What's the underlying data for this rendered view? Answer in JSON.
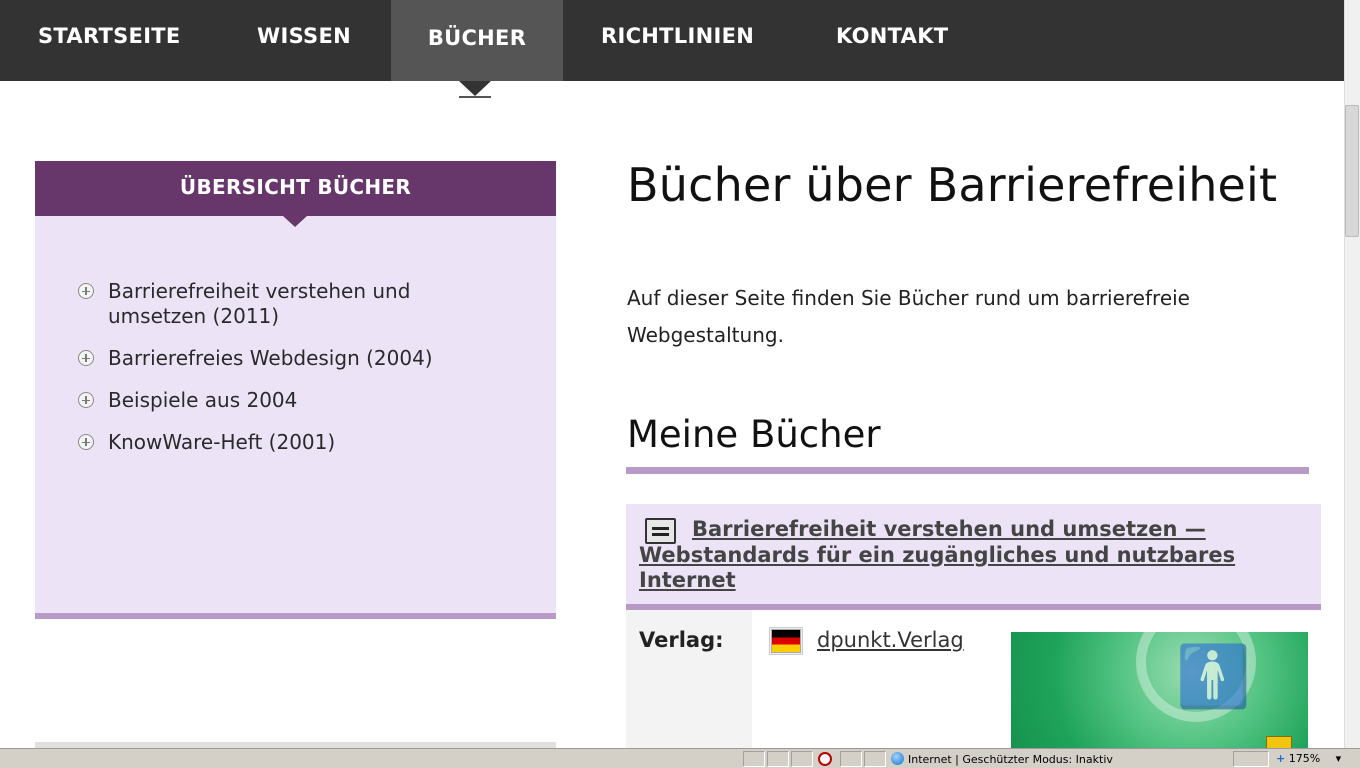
{
  "nav": {
    "items": [
      {
        "label": "STARTSEITE",
        "active": false
      },
      {
        "label": "WISSEN",
        "active": false
      },
      {
        "label": "BÜCHER",
        "active": true
      },
      {
        "label": "RICHTLINIEN",
        "active": false
      },
      {
        "label": "KONTAKT",
        "active": false
      }
    ]
  },
  "sidebar": {
    "title": "ÜBERSICHT BÜCHER",
    "items": [
      {
        "label": "Barrierefreiheit verstehen und umsetzen (2011)"
      },
      {
        "label": "Barrierefreies Webdesign (2004)"
      },
      {
        "label": "Beispiele aus 2004"
      },
      {
        "label": "KnowWare-Heft (2001)"
      }
    ]
  },
  "main": {
    "title": "Bücher über Barrierefreiheit",
    "intro": "Auf dieser Seite finden Sie Bücher rund um barrierefreie Webgestaltung.",
    "section_title": "Meine Bücher",
    "book": {
      "title": "Barrierefreiheit verstehen und umsetzen — Webstandards für ein zugängliches und nutzbares Internet",
      "publisher_label": "Verlag:",
      "publisher_name": "dpunkt.Verlag",
      "flag_icon": "german-flag-icon"
    }
  },
  "statusbar": {
    "zone_text": "Internet | Geschützter Modus: Inaktiv",
    "zoom": "175%"
  },
  "colors": {
    "nav_bg": "#333333",
    "nav_active_bg": "#555555",
    "sidebar_header": "#67366b",
    "sidebar_bg": "#ede3f7",
    "accent_rule": "#b79ac8"
  }
}
